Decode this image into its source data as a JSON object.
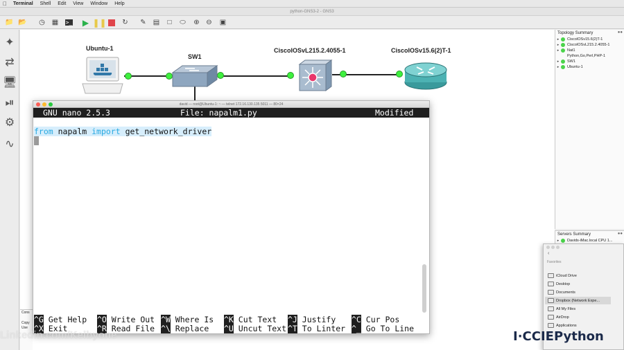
{
  "menubar": {
    "app": "Terminal",
    "items": [
      "Shell",
      "Edit",
      "View",
      "Window",
      "Help"
    ]
  },
  "window_title": "python-GNS3-2 - GNS3",
  "topology": {
    "devices": {
      "ubuntu": "Ubuntu-1",
      "switch": "SW1",
      "l2router": "CiscoIOSvL215.2.4055-1",
      "router": "CiscoIOSv15.6(2)T-1"
    }
  },
  "topology_summary": {
    "title": "Topology Summary",
    "items": [
      "CiscoIOSv15.6(2)T-1",
      "CiscoIOSvL215.2.4055-1",
      "Nat1",
      "Python,Go,Perl,PHP-1",
      "SW1",
      "Ubuntu-1"
    ]
  },
  "servers_summary": {
    "title": "Servers Summary",
    "items": [
      "Davids-iMac.local CPU 1..."
    ]
  },
  "terminal": {
    "title": "david — root@Ubuntu-1: ~ — telnet 172.16.130.135 5011 — 80×24",
    "nano_version": "GNU nano 2.5.3",
    "file_label": "File: napalm1.py",
    "status": "Modified",
    "code_line": {
      "kw1": "from",
      "mod": " napalm ",
      "kw2": "import",
      "rest": " get_network_driver"
    },
    "shortcuts": [
      {
        "key": "^G",
        "label": " Get Help"
      },
      {
        "key": "^O",
        "label": " Write Out"
      },
      {
        "key": "^W",
        "label": " Where Is"
      },
      {
        "key": "^K",
        "label": " Cut Text"
      },
      {
        "key": "^J",
        "label": " Justify"
      },
      {
        "key": "^C",
        "label": " Cur Pos"
      },
      {
        "key": "^X",
        "label": " Exit"
      },
      {
        "key": "^R",
        "label": " Read File"
      },
      {
        "key": "^\\",
        "label": " Replace"
      },
      {
        "key": "^U",
        "label": " Uncut Text"
      },
      {
        "key": "^T",
        "label": " To Linter"
      },
      {
        "key": "^_",
        "label": " Go To Line"
      }
    ]
  },
  "console_dock": {
    "lines": [
      "Cons",
      "Copy",
      "Use"
    ]
  },
  "finder": {
    "section": "Favorites",
    "items": [
      "iCloud Drive",
      "Desktop",
      "Documents",
      "Dropbox (Network Expe...",
      "All My Files",
      "AirDrop",
      "Applications"
    ]
  },
  "watermark": "Linkedin.com/Kelbyone",
  "logo_text": "CCIEPython",
  "colors": {
    "link_green": "#3ef03e",
    "nano_bar": "#1f1f1f",
    "keyword": "#27a9e1",
    "stop_red": "#e0454b",
    "play_green": "#2bb24c"
  }
}
